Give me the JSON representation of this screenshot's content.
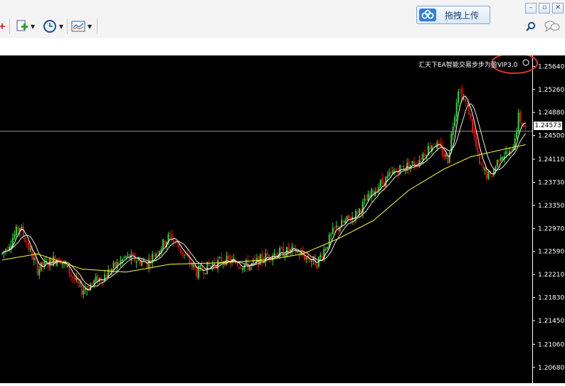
{
  "toolbar": {
    "upload_label": "拖拽上传",
    "icons": [
      "crosshair-icon",
      "new-chart-icon",
      "clock-icon",
      "template-icon",
      "search-icon",
      "chat-icon",
      "cloud-upload-icon"
    ],
    "window_buttons": {
      "minimize": "–",
      "restore": "▫",
      "close": "✕"
    }
  },
  "chart": {
    "ea_label": "汇天下EA智能交易步步为盈VIP3.0",
    "current_price": "1.24573",
    "price_levels": [
      "1.25640",
      "1.25260",
      "1.24880",
      "1.24500",
      "1.24110",
      "1.23730",
      "1.23350",
      "1.22970",
      "1.22590",
      "1.22210",
      "1.21830",
      "1.21450",
      "1.21060",
      "1.20680"
    ],
    "colors": {
      "bull": "#35d43c",
      "bear": "#e01010",
      "ma_fast": "#ffffff",
      "ma_slow": "#ffff33",
      "annotation": "#e03030"
    }
  },
  "chart_data": {
    "type": "candlestick",
    "yaxis_ticks": [
      1.2564,
      1.2526,
      1.2488,
      1.245,
      1.2411,
      1.2373,
      1.2335,
      1.2297,
      1.2259,
      1.2221,
      1.2183,
      1.2145,
      1.2106,
      1.2068
    ],
    "ylim": [
      1.2042,
      1.2582
    ],
    "current_price": 1.24573,
    "trend_anchors": [
      [
        0,
        1.2255
      ],
      [
        10,
        1.23
      ],
      [
        20,
        1.223
      ],
      [
        32,
        1.225
      ],
      [
        45,
        1.2195
      ],
      [
        58,
        1.222
      ],
      [
        70,
        1.225
      ],
      [
        82,
        1.224
      ],
      [
        95,
        1.2285
      ],
      [
        110,
        1.2225
      ],
      [
        125,
        1.2245
      ],
      [
        140,
        1.2235
      ],
      [
        152,
        1.2255
      ],
      [
        165,
        1.226
      ],
      [
        178,
        1.224
      ],
      [
        188,
        1.2295
      ],
      [
        200,
        1.232
      ],
      [
        212,
        1.2365
      ],
      [
        224,
        1.2395
      ],
      [
        234,
        1.2405
      ],
      [
        244,
        1.244
      ],
      [
        252,
        1.241
      ],
      [
        258,
        1.253
      ],
      [
        264,
        1.249
      ],
      [
        270,
        1.24
      ],
      [
        276,
        1.238
      ],
      [
        282,
        1.242
      ],
      [
        288,
        1.242
      ],
      [
        292,
        1.248
      ],
      [
        296,
        1.246
      ]
    ],
    "ma_slow_anchors": [
      [
        0,
        1.2245
      ],
      [
        20,
        1.2255
      ],
      [
        45,
        1.223
      ],
      [
        70,
        1.2225
      ],
      [
        95,
        1.2238
      ],
      [
        120,
        1.224
      ],
      [
        150,
        1.2245
      ],
      [
        170,
        1.2255
      ],
      [
        190,
        1.228
      ],
      [
        210,
        1.231
      ],
      [
        230,
        1.236
      ],
      [
        250,
        1.2395
      ],
      [
        265,
        1.2415
      ],
      [
        280,
        1.2425
      ],
      [
        296,
        1.2435
      ]
    ]
  }
}
